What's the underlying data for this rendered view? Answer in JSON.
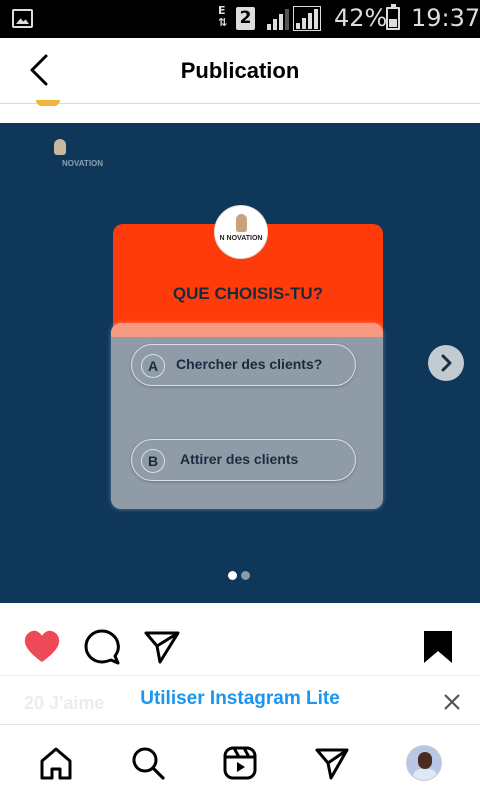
{
  "status_bar": {
    "network_letter": "E",
    "sim_slot": "2",
    "battery_percent": "42%",
    "battery_level": 0.42,
    "time": "19:37"
  },
  "header": {
    "title": "Publication",
    "back_icon": "chevron-left-icon"
  },
  "post": {
    "background_color": "#0f3759",
    "brand_logo_text": "NOVATION",
    "card_logo_text": "N NOVATION",
    "question": "QUE CHOISIS-TU?",
    "options": [
      {
        "letter": "A",
        "label": "Chercher des clients?"
      },
      {
        "letter": "B",
        "label": "Attirer des clients"
      }
    ],
    "carousel": {
      "total": 2,
      "active_index": 0
    }
  },
  "actions": {
    "like_icon": "heart-filled-icon",
    "comment_icon": "comment-icon",
    "share_icon": "send-icon",
    "save_icon": "bookmark-filled-icon",
    "like_color": "#ed4956"
  },
  "banner": {
    "likes_text": "20 J'aime",
    "cta": "Utiliser Instagram Lite",
    "cta_color": "#1a95f0"
  },
  "bottom_nav": {
    "items": [
      "home-icon",
      "search-icon",
      "reels-icon",
      "direct-icon",
      "profile-avatar"
    ]
  },
  "colors": {
    "orange_card": "#ff3b0b",
    "gray_card": "#8f9ca8",
    "text_dark": "#1b2b3f"
  }
}
